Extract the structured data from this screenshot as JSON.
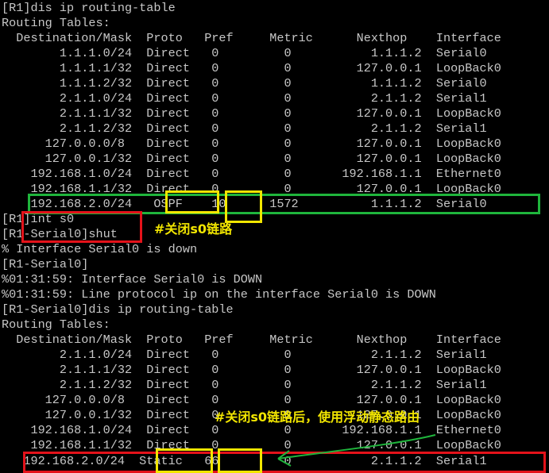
{
  "terminal": {
    "lines": [
      "[R1]dis ip routing-table",
      "Routing Tables:",
      "  Destination/Mask  Proto   Pref     Metric      Nexthop    Interface",
      "        1.1.1.0/24  Direct   0         0           1.1.1.2  Serial0",
      "        1.1.1.1/32  Direct   0         0         127.0.0.1  LoopBack0",
      "        1.1.1.2/32  Direct   0         0           1.1.1.2  Serial0",
      "        2.1.1.0/24  Direct   0         0           2.1.1.2  Serial1",
      "        2.1.1.1/32  Direct   0         0         127.0.0.1  LoopBack0",
      "        2.1.1.2/32  Direct   0         0           2.1.1.2  Serial1",
      "      127.0.0.0/8   Direct   0         0         127.0.0.1  LoopBack0",
      "      127.0.0.1/32  Direct   0         0         127.0.0.1  LoopBack0",
      "    192.168.1.0/24  Direct   0         0       192.168.1.1  Ethernet0",
      "    192.168.1.1/32  Direct   0         0         127.0.0.1  LoopBack0",
      "    192.168.2.0/24   OSPF    10      1572          1.1.1.2  Serial0",
      "[R1]int s0",
      "[R1-Serial0]shut",
      "% Interface Serial0 is down",
      "[R1-Serial0]",
      "%01:31:59: Interface Serial0 is DOWN",
      "%01:31:59: Line protocol ip on the interface Serial0 is DOWN",
      "[R1-Serial0]dis ip routing-table",
      "Routing Tables:",
      "  Destination/Mask  Proto   Pref     Metric      Nexthop    Interface",
      "        2.1.1.0/24  Direct   0         0           2.1.1.2  Serial1",
      "        2.1.1.1/32  Direct   0         0         127.0.0.1  LoopBack0",
      "        2.1.1.2/32  Direct   0         0           2.1.1.2  Serial1",
      "      127.0.0.0/8   Direct   0         0         127.0.0.1  LoopBack0",
      "      127.0.0.1/32  Direct   0         0         127.0.0.1  LoopBack0",
      "    192.168.1.0/24  Direct   0         0       192.168.1.1  Ethernet0",
      "    192.168.1.1/32  Direct   0         0         127.0.0.1  LoopBack0",
      "   192.168.2.0/24  Static   66         0           2.1.1.2  Serial1"
    ]
  },
  "annotations": {
    "shutdown_note": "#关闭s0链路",
    "static_note": "#关闭s0链路后，使用浮动静态路由"
  },
  "colors": {
    "background": "#000000",
    "text": "#c7c7c7",
    "green_box": "#1fb53c",
    "yellow_box": "#f2e600",
    "red_box": "#e4121a",
    "note_text": "#f2e600"
  }
}
